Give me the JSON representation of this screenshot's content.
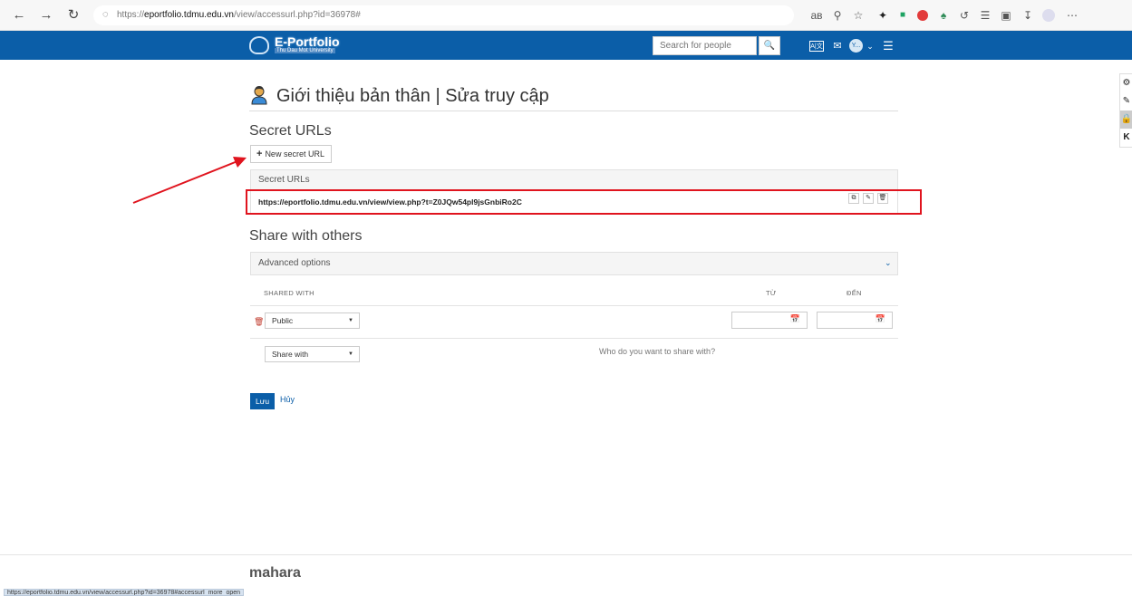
{
  "browser": {
    "url_prefix": "https://",
    "url_host": "eportfolio.tdmu.edu.vn",
    "url_path": "/view/accessurl.php?id=36978#",
    "status_url": "https://eportfolio.tdmu.edu.vn/view/accessurl.php?id=36978#accessurl_more_open",
    "nav": {
      "back": "←",
      "forward": "→",
      "reload": "↻"
    },
    "extension_icons": [
      "read-aloud-icon",
      "zoom-icon",
      "favorite-icon",
      "extension-icon",
      "extension-icon",
      "adblock-icon",
      "extension-icon",
      "extension-icon",
      "favorites-icon",
      "collections-icon",
      "downloads-icon",
      "profile-icon",
      "more-icon"
    ]
  },
  "site_header": {
    "logo_title": "E-Portfolio",
    "logo_subtitle": "Thu Dau Mot University",
    "search_placeholder": "Search for people",
    "avatar_initials": "Y..."
  },
  "side_tools": [
    "gear-icon",
    "pencil-icon",
    "lock-icon",
    "key-icon"
  ],
  "page": {
    "title": "Giới thiệu bản thân | Sửa truy cập",
    "secret_section_title": "Secret URLs",
    "new_secret_url_label": "New secret URL",
    "secret_panel_heading": "Secret URLs",
    "secret_url": "https://eportfolio.tdmu.edu.vn/view/view.php?t=Z0JQw54pl9jsGnbiRo2C",
    "share_section_title": "Share with others",
    "advanced_options_label": "Advanced options",
    "table_headers": {
      "shared_with": "SHARED WITH",
      "from": "TỪ",
      "to": "ĐẾN"
    },
    "rows": [
      {
        "select_value": "Public"
      }
    ],
    "share_with_select": "Share with",
    "share_with_hint": "Who do you want to share with?",
    "save_label": "Lưu",
    "cancel_label": "Hủy"
  },
  "footer": {
    "powered_by": "mahara"
  },
  "colors": {
    "brand_blue": "#0b5ea8",
    "annotation_red": "#e0141e"
  }
}
